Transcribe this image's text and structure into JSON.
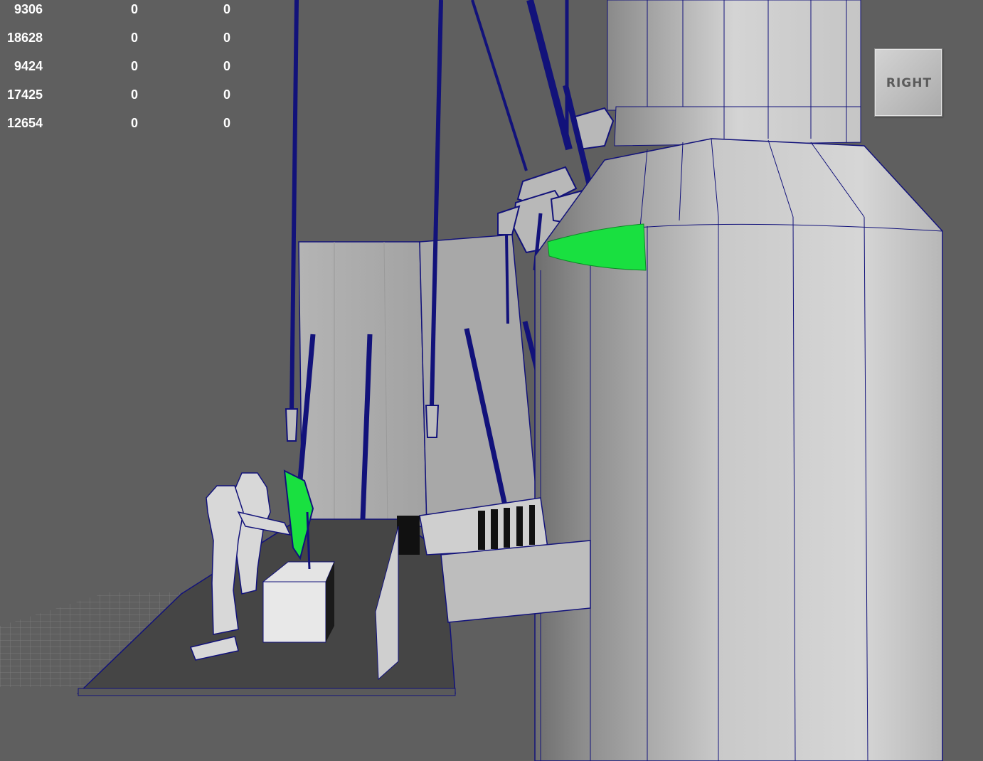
{
  "hud_stats": {
    "rows": [
      [
        "9306",
        "0",
        "0"
      ],
      [
        "18628",
        "0",
        "0"
      ],
      [
        "9424",
        "0",
        "0"
      ],
      [
        "17425",
        "0",
        "0"
      ],
      [
        "12654",
        "0",
        "0"
      ]
    ]
  },
  "view_cube": {
    "label": "RIGHT"
  },
  "colors": {
    "background": "#5f5f5f",
    "wire": "#12127a",
    "selection": "#19e040",
    "surface_light": "#c4c4c4",
    "surface_dark": "#444444",
    "grid": "#7a7a7a",
    "hud_text": "#ffffff"
  }
}
